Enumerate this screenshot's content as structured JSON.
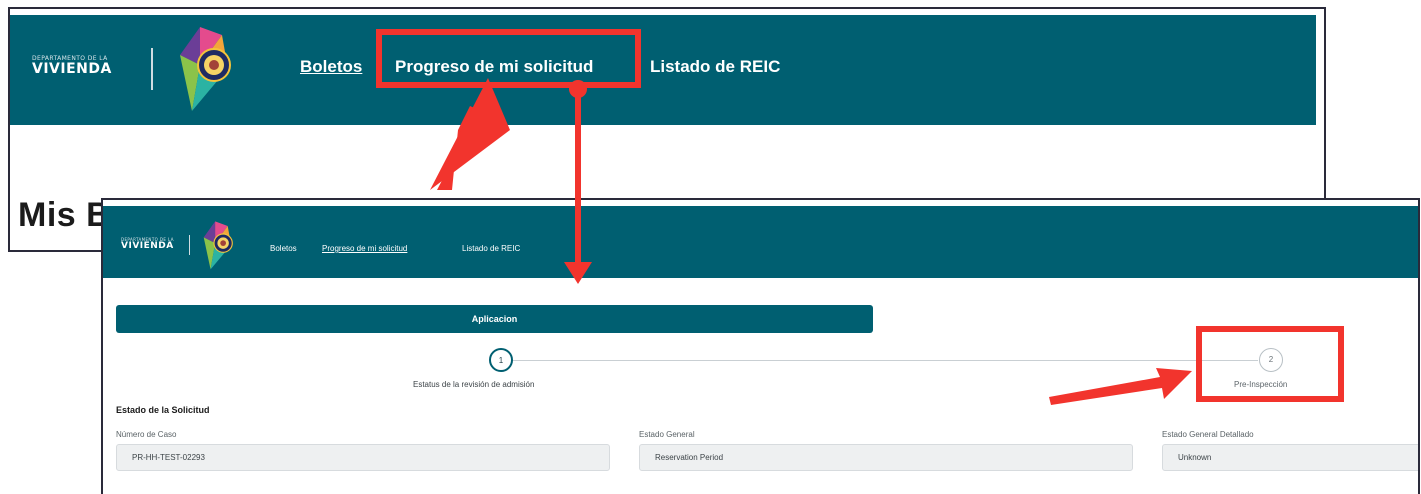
{
  "back_screenshot": {
    "logo": {
      "small_text": "DEPARTAMENTO DE LA",
      "brand_text": "VIVIENDA"
    },
    "nav": {
      "boletos": "Boletos",
      "progreso": "Progreso de mi solicitud",
      "listado": "Listado de REIC"
    },
    "page_title": "Mis Boletos"
  },
  "front_screenshot": {
    "logo": {
      "small_text": "DEPARTAMENTO DE LA",
      "brand_text": "VIVIENDA"
    },
    "nav": {
      "boletos": "Boletos",
      "progreso": "Progreso de mi solicitud",
      "listado": "Listado de REIC"
    },
    "tab_label": "Aplicacion",
    "steps": [
      {
        "number": "1",
        "label": "Estatus de la revisión de admisión",
        "state": "active"
      },
      {
        "number": "2",
        "label": "Pre-Inspección",
        "state": "inactive"
      }
    ],
    "section_title": "Estado de la Solicitud",
    "fields": [
      {
        "label": "Número de Caso",
        "value": "PR-HH-TEST-02293"
      },
      {
        "label": "Estado General",
        "value": "Reservation Period"
      },
      {
        "label": "Estado General Detallado",
        "value": "Unknown"
      }
    ]
  },
  "colors": {
    "nav_teal": "#005f71",
    "annotation_red": "#f2342d",
    "field_bg": "#eef0f1"
  },
  "icons": [
    "puerto-rico-seal-icon",
    "annotation-arrow-icon"
  ]
}
